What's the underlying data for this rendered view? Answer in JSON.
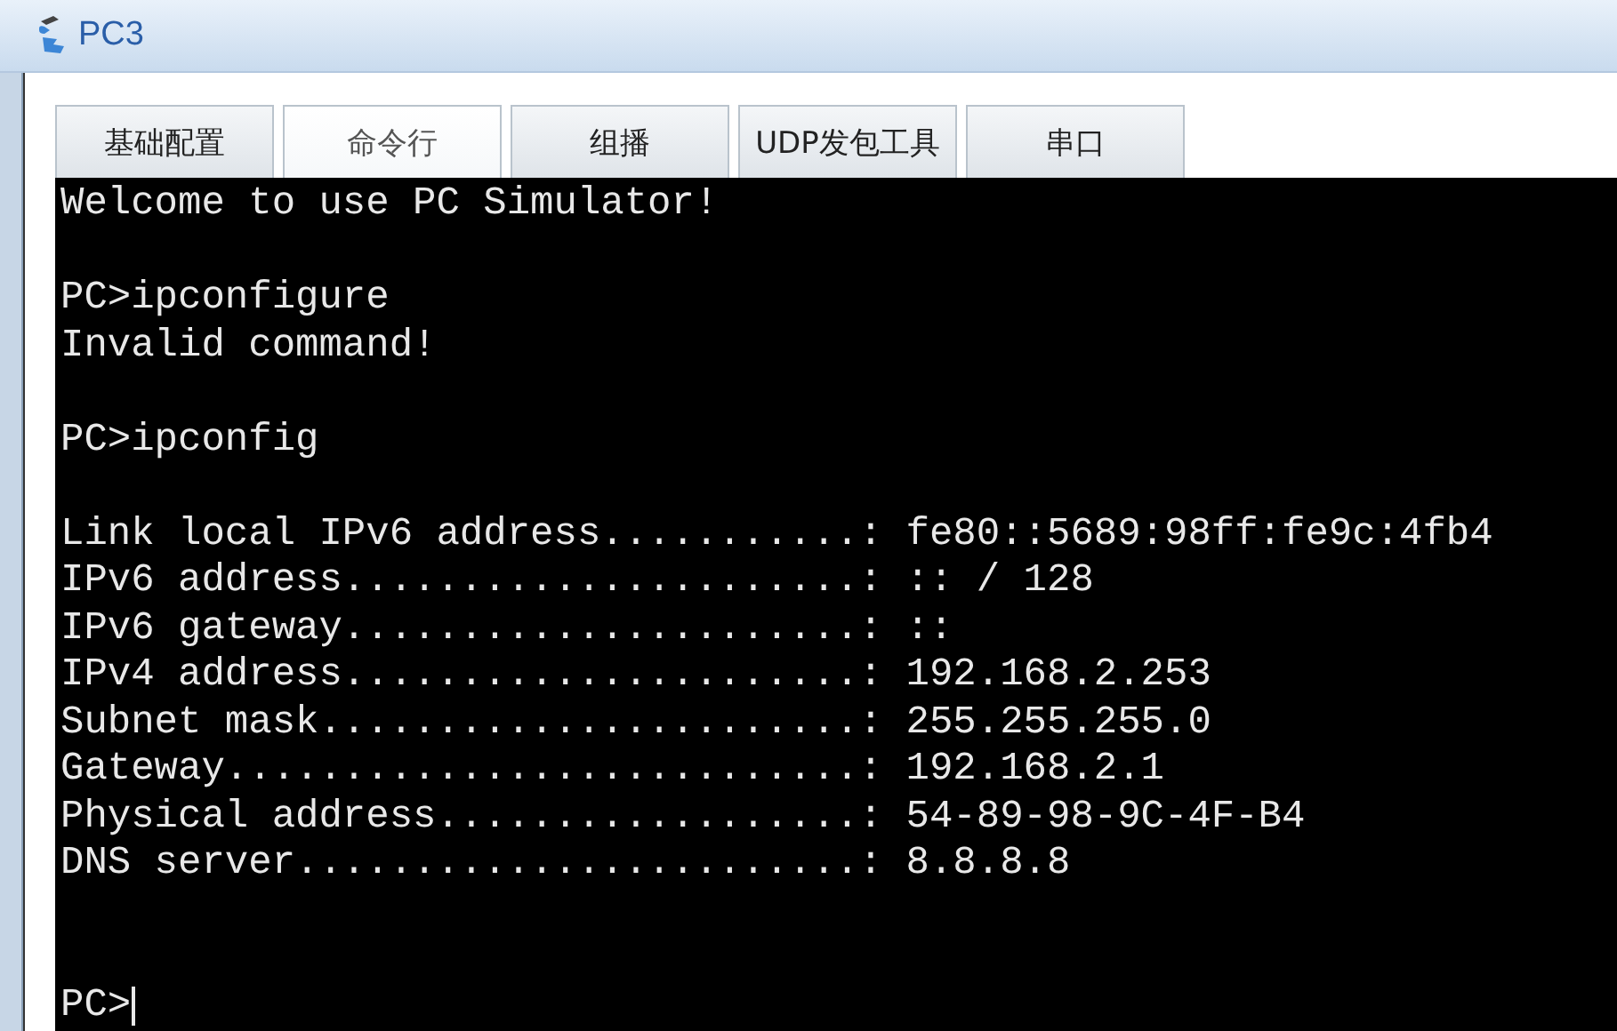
{
  "window": {
    "title": "PC3"
  },
  "tabs": [
    {
      "label": "基础配置",
      "selected": false
    },
    {
      "label": "命令行",
      "selected": true
    },
    {
      "label": "组播",
      "selected": false
    },
    {
      "label": "UDP发包工具",
      "selected": false
    },
    {
      "label": "串口",
      "selected": false
    }
  ],
  "terminal": {
    "lines": [
      {
        "kind": "text",
        "text": "Welcome to use PC Simulator!"
      },
      {
        "kind": "blank"
      },
      {
        "kind": "text",
        "text": "PC>ipconfigure"
      },
      {
        "kind": "text",
        "text": "Invalid command!"
      },
      {
        "kind": "blank"
      },
      {
        "kind": "text",
        "text": "PC>ipconfig"
      },
      {
        "kind": "blank"
      },
      {
        "kind": "text",
        "text": "Link local IPv6 address...........: fe80::5689:98ff:fe9c:4fb4"
      },
      {
        "kind": "text",
        "text": "IPv6 address......................: :: / 128"
      },
      {
        "kind": "text",
        "text": "IPv6 gateway......................: ::"
      },
      {
        "kind": "text",
        "text": "IPv4 address......................: 192.168.2.253"
      },
      {
        "kind": "text",
        "text": "Subnet mask.......................: 255.255.255.0"
      },
      {
        "kind": "text",
        "text": "Gateway...........................: 192.168.2.1"
      },
      {
        "kind": "text",
        "text": "Physical address..................: 54-89-98-9C-4F-B4"
      },
      {
        "kind": "text",
        "text": "DNS server........................: 8.8.8.8"
      },
      {
        "kind": "blank"
      },
      {
        "kind": "blank"
      },
      {
        "kind": "prompt",
        "text": "PC>"
      }
    ]
  }
}
